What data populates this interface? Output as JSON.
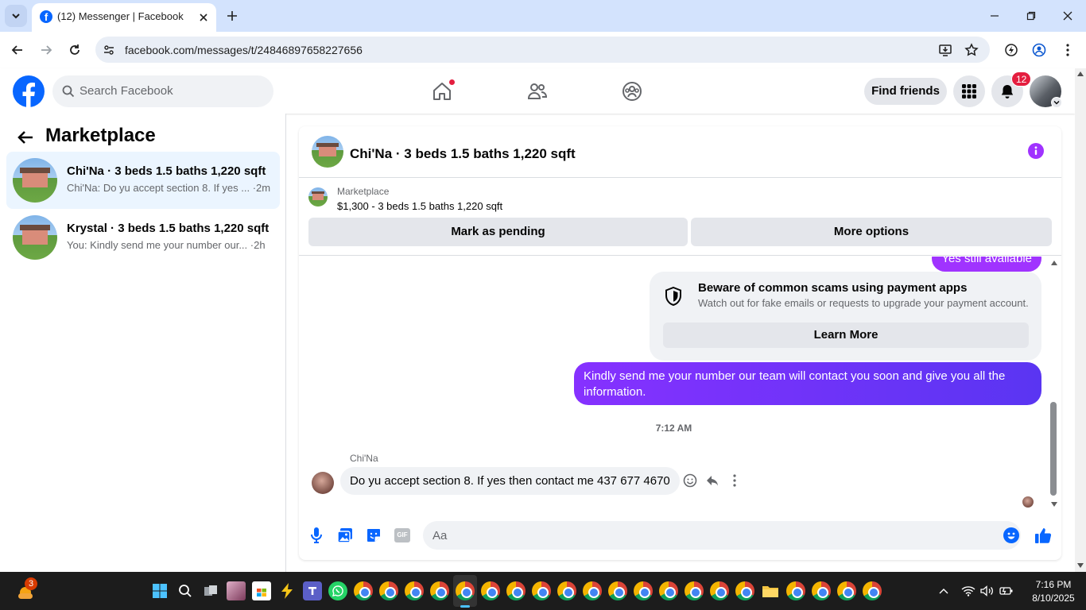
{
  "browser": {
    "tab_title": "(12) Messenger | Facebook",
    "url": "facebook.com/messages/t/24846897658227656"
  },
  "fb_header": {
    "search_placeholder": "Search Facebook",
    "find_friends": "Find friends",
    "notification_count": "12"
  },
  "sidebar": {
    "title": "Marketplace",
    "conversations": [
      {
        "title": "Chi'Na · 3 beds 1.5 baths 1,220 sqft",
        "preview": "Chi'Na: Do yu accept section 8. If yes ... ·2m",
        "active": true
      },
      {
        "title": "Krystal · 3 beds 1.5 baths 1,220 sqft",
        "preview": "You: Kindly send me your number our... ·2h",
        "active": false
      }
    ]
  },
  "chat": {
    "title": "Chi'Na · 3 beds 1.5 baths 1,220 sqft",
    "listing_source": "Marketplace",
    "listing_price": "$1,300 - 3 beds 1.5 baths 1,220 sqft",
    "mark_pending": "Mark as pending",
    "more_options": "More options",
    "prev_message": "Yes still available",
    "scam_title": "Beware of common scams using payment apps",
    "scam_text": "Watch out for fake emails or requests to upgrade your payment account.",
    "learn_more": "Learn More",
    "outgoing_message": "Kindly send me your number our team will contact you soon and give you all the information.",
    "timestamp": "7:12 AM",
    "sender_name": "Chi'Na",
    "incoming_message": "Do yu accept section 8. If yes then contact me 437 677 4670",
    "composer_placeholder": "Aa",
    "gif_label": "GIF"
  },
  "taskbar": {
    "weather_badge": "3",
    "time": "7:16 PM",
    "date": "8/10/2025"
  },
  "colors": {
    "fb_blue": "#0866ff",
    "outgoing_gradient_start": "#8631ff",
    "outgoing_gradient_end": "#5a35f2",
    "info_purple": "#a033ff",
    "badge_red": "#e41e3f"
  }
}
